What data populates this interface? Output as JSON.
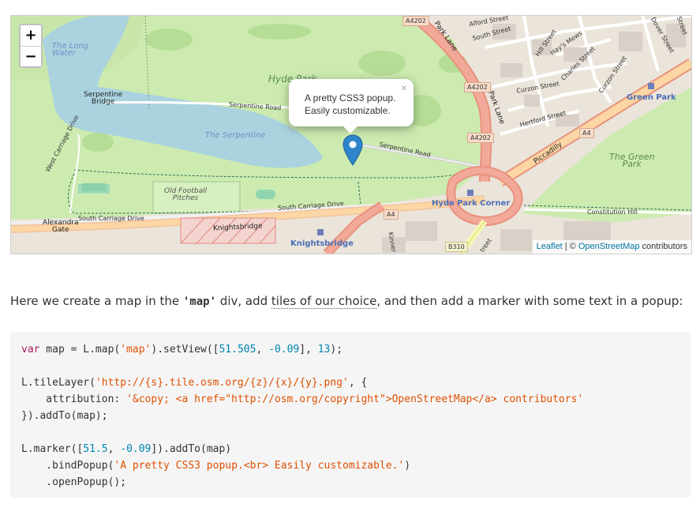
{
  "map": {
    "zoom_in_label": "+",
    "zoom_out_label": "−",
    "popup": {
      "line1": "A pretty CSS3 popup.",
      "line2": "Easily customizable.",
      "close": "×"
    },
    "labels": {
      "long_water_1": "The Long",
      "long_water_2": "Water",
      "hyde_park": "Hyde Park",
      "serpentine_bridge_1": "Serpentine",
      "serpentine_bridge_2": "Bridge",
      "serpentine_road_1": "Serpentine Road",
      "serpentine_road_2": "Serpentine Road",
      "the_serpentine": "The Serpentine",
      "west_carriage_drive": "West Carriage Drive",
      "old_football_1": "Old Football",
      "old_football_2": "Pitches",
      "south_carriage_drive_1": "South Carriage Drive",
      "south_carriage_drive_2": "South Carriage Drive",
      "alexandra_gate_1": "Alexandra",
      "alexandra_gate_2": "Gate",
      "knightsbridge_road": "Knightsbridge",
      "knightsbridge_station": "Knightsbridge",
      "hyde_park_corner": "Hyde Park Corner",
      "green_park_station": "Green Park",
      "the_green_park_1": "The Green",
      "the_green_park_2": "Park",
      "piccadilly": "Piccadilly",
      "park_lane": "Park Lane",
      "park_lane_2": "Park Lane",
      "curzon_street": "Curzon Street",
      "curzon_street_2": "Curzon Street",
      "hertford_street": "Hertford Street",
      "charles_street": "Charles Street",
      "hays_mews": "Hay's Mews",
      "hill_street": "Hill Street",
      "south_street": "South Street",
      "alford_street": "Alford Street",
      "dover_street": "Dover Street",
      "constitution_hill": "Constitution Hill",
      "kinnerton": "Kinner",
      "street_fragment": "treet",
      "street_fragment_2": "Street"
    },
    "shields": {
      "a4202_top": "A4202",
      "a4202_mid": "A4202",
      "a4202_low": "A4202",
      "a4_right": "A4",
      "a4_mid": "A4",
      "b310": "B310"
    },
    "attribution": {
      "leaflet": "Leaflet",
      "sep": " | © ",
      "osm": "OpenStreetMap",
      "suffix": " contributors"
    }
  },
  "intro": {
    "before": "Here we create a map in the ",
    "code": "'map'",
    "middle": " div, add ",
    "link": "tiles of our choice",
    "after": ", and then add a marker with some text in a popup:"
  },
  "code": {
    "l1_kw": "var",
    "l1_a": " map = L.map(",
    "l1_s": "'map'",
    "l1_b": ").setView([",
    "l1_n1": "51.505",
    "l1_c": ", ",
    "l1_n2": "-0.09",
    "l1_d": "], ",
    "l1_n3": "13",
    "l1_e": ");",
    "l3_a": "L.tileLayer(",
    "l3_s": "'http://{s}.tile.osm.org/{z}/{x}/{y}.png'",
    "l3_b": ", {",
    "l4_a": "    attribution: ",
    "l4_s": "'&copy; <a href=\"http://osm.org/copyright\">OpenStreetMap</a> contributors'",
    "l5": "}).addTo(map);",
    "l7_a": "L.marker([",
    "l7_n1": "51.5",
    "l7_b": ", ",
    "l7_n2": "-0.09",
    "l7_c": "]).addTo(map)",
    "l8_a": "    .bindPopup(",
    "l8_s": "'A pretty CSS3 popup.<br> Easily customizable.'",
    "l8_b": ")",
    "l9": "    .openPopup();"
  }
}
